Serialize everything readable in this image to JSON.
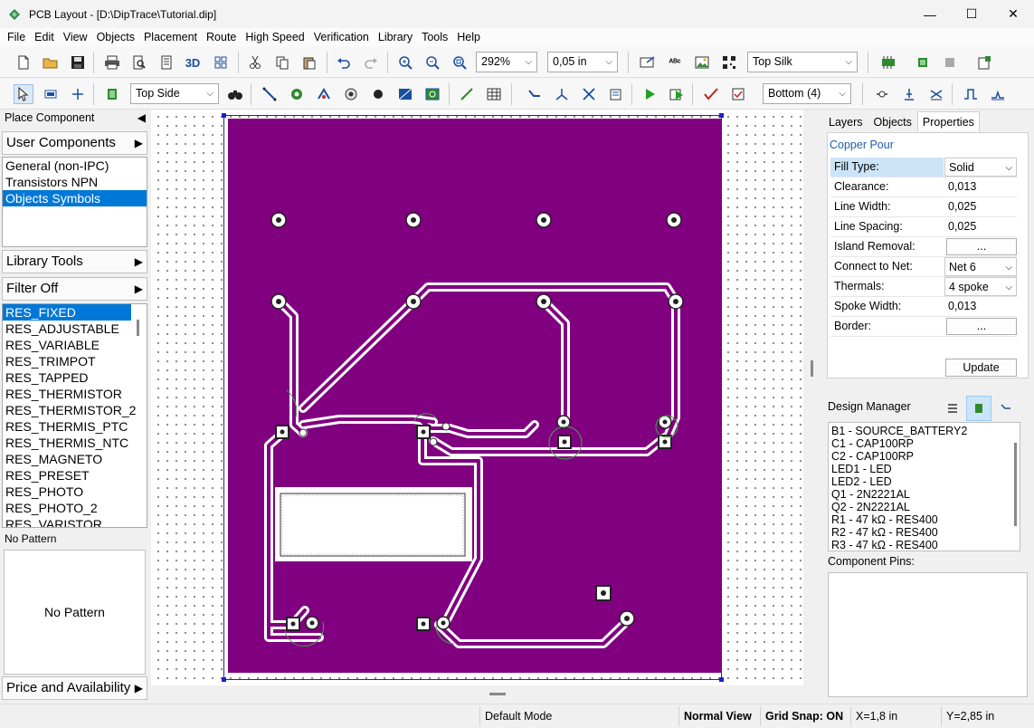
{
  "window": {
    "title": "PCB Layout - [D:\\DipTrace\\Tutorial.dip]",
    "minimize": "—",
    "maximize": "☐",
    "close": "✕"
  },
  "menu": [
    "File",
    "Edit",
    "View",
    "Objects",
    "Placement",
    "Route",
    "High Speed",
    "Verification",
    "Library",
    "Tools",
    "Help"
  ],
  "toolbar": {
    "view3d_label": "3D",
    "zoom_value": "292%",
    "grid_value": "0,05 in",
    "silk_layer": "Top Silk",
    "side_value": "Top Side",
    "route_layer": "Bottom (4)"
  },
  "left_panel": {
    "place_component": "Place Component",
    "user_components": "User Components",
    "groups": [
      "General (non-IPC)",
      "Transistors NPN",
      "Objects Symbols"
    ],
    "selected_group": "Objects Symbols",
    "library_tools": "Library Tools",
    "filter": "Filter Off",
    "components": [
      "RES_FIXED",
      "RES_ADJUSTABLE",
      "RES_VARIABLE",
      "RES_TRIMPOT",
      "RES_TAPPED",
      "RES_THERMISTOR",
      "RES_THERMISTOR_2",
      "RES_THERMIS_PTC",
      "RES_THERMIS_NTC",
      "RES_MAGNETO",
      "RES_PRESET",
      "RES_PHOTO",
      "RES_PHOTO_2",
      "RES_VARISTOR"
    ],
    "selected_component": "RES_FIXED",
    "pattern_label": "No Pattern",
    "pattern_preview": "No Pattern",
    "price": "Price and Availability"
  },
  "right_panel": {
    "tabs": [
      "Layers",
      "Objects",
      "Properties"
    ],
    "active_tab": "Properties",
    "object_title": "Copper Pour",
    "properties": [
      {
        "name": "Fill Type:",
        "value": "Solid",
        "kind": "combo"
      },
      {
        "name": "Clearance:",
        "value": "0,013",
        "kind": "text"
      },
      {
        "name": "Line Width:",
        "value": "0,025",
        "kind": "text"
      },
      {
        "name": "Line Spacing:",
        "value": "0,025",
        "kind": "text"
      },
      {
        "name": "Island Removal:",
        "value": "...",
        "kind": "button"
      },
      {
        "name": "Connect to Net:",
        "value": "Net 6",
        "kind": "combo"
      },
      {
        "name": "Thermals:",
        "value": "4 spoke",
        "kind": "combo"
      },
      {
        "name": "Spoke Width:",
        "value": "0,013",
        "kind": "text"
      },
      {
        "name": "Border:",
        "value": "...",
        "kind": "button"
      }
    ],
    "update_label": "Update",
    "design_manager_label": "Design Manager",
    "design_items": [
      "B1 - SOURCE_BATTERY2",
      "C1 - CAP100RP",
      "C2 - CAP100RP",
      "LED1 - LED",
      "LED2 - LED",
      "Q1 - 2N2221AL",
      "Q2 - 2N2221AL",
      "R1 - 47 kΩ - RES400",
      "R2 - 47 kΩ - RES400",
      "R3 - 47 kΩ - RES400"
    ],
    "component_pins_label": "Component Pins:"
  },
  "status": {
    "mode": "Default Mode",
    "view": "Normal View",
    "grid_snap": "Grid Snap: ON",
    "x": "X=1,8 in",
    "y": "Y=2,85 in"
  },
  "colors": {
    "copper_pour": "#800080",
    "selection": "#0078d7",
    "accent_text": "#1f5fa8"
  }
}
